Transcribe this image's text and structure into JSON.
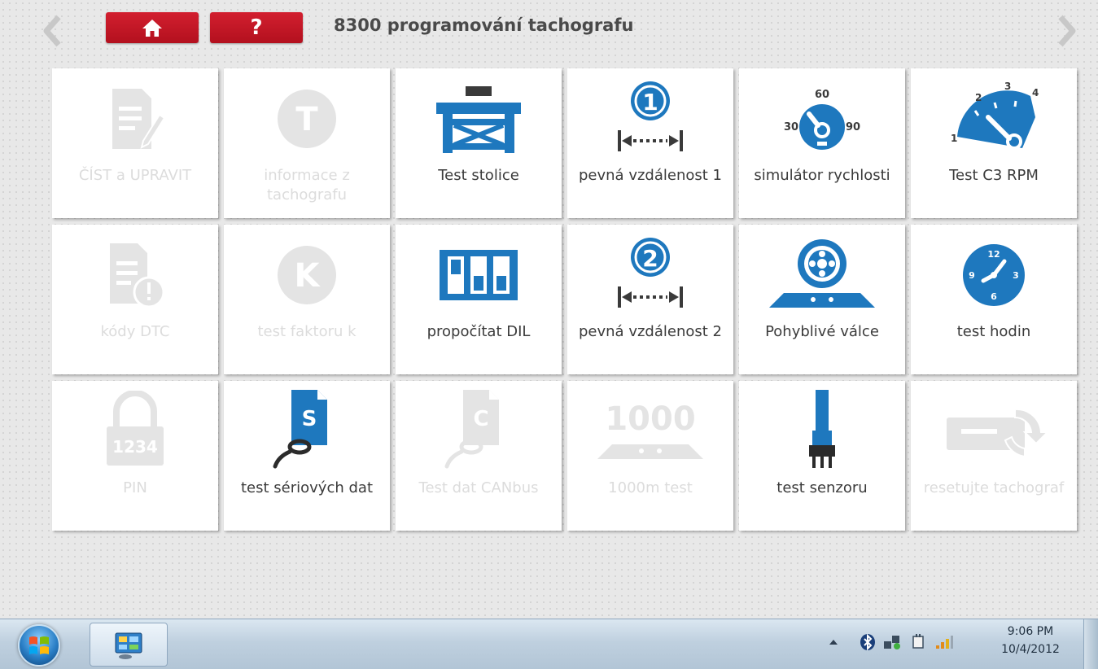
{
  "header": {
    "title": "8300 programování tachografu",
    "help_label": "?"
  },
  "tiles": [
    {
      "label": "ČÍST a UPRAVIT",
      "enabled": false,
      "icon": "edit-document-icon"
    },
    {
      "label": "informace z tachografu",
      "enabled": false,
      "icon": "t-circle-icon"
    },
    {
      "label": "Test stolice",
      "enabled": true,
      "icon": "test-bench-icon"
    },
    {
      "label": "pevná vzdálenost 1",
      "enabled": true,
      "icon": "fixed-distance-1-icon"
    },
    {
      "label": "simulátor rychlosti",
      "enabled": true,
      "icon": "speed-dial-icon"
    },
    {
      "label": "Test C3 RPM",
      "enabled": true,
      "icon": "rpm-gauge-icon"
    },
    {
      "label": "kódy DTC",
      "enabled": false,
      "icon": "dtc-document-icon"
    },
    {
      "label": "test faktoru k",
      "enabled": false,
      "icon": "k-circle-icon"
    },
    {
      "label": "propočítat DIL",
      "enabled": true,
      "icon": "dil-switch-icon"
    },
    {
      "label": "pevná vzdálenost 2",
      "enabled": true,
      "icon": "fixed-distance-2-icon"
    },
    {
      "label": "Pohyblivé válce",
      "enabled": true,
      "icon": "rolling-road-icon"
    },
    {
      "label": "test hodin",
      "enabled": true,
      "icon": "clock-icon"
    },
    {
      "label": "PIN",
      "enabled": false,
      "icon": "padlock-icon"
    },
    {
      "label": "test sériových dat",
      "enabled": true,
      "icon": "serial-data-icon"
    },
    {
      "label": "Test dat CANbus",
      "enabled": false,
      "icon": "canbus-data-icon"
    },
    {
      "label": "1000m test",
      "enabled": false,
      "icon": "1000m-icon"
    },
    {
      "label": "test senzoru",
      "enabled": true,
      "icon": "sensor-icon"
    },
    {
      "label": "resetujte tachograf",
      "enabled": false,
      "icon": "reset-tachograph-icon"
    }
  ],
  "icon_texts": {
    "pin_code": "1234",
    "serial_letter": "S",
    "canbus_letter": "C",
    "distance_1": "1",
    "distance_2": "2",
    "speed_30": "30",
    "speed_60": "60",
    "speed_90": "90",
    "rpm_1": "1",
    "rpm_2": "2",
    "rpm_3": "3",
    "rpm_4": "4",
    "clock_12": "12",
    "clock_3": "3",
    "clock_6": "6",
    "clock_9": "9",
    "thousand": "1000",
    "letter_t": "T",
    "letter_k": "K"
  },
  "taskbar": {
    "time": "9:06 PM",
    "date": "10/4/2012"
  },
  "colors": {
    "accent_red": "#c8141f",
    "icon_blue": "#1e78be",
    "disabled_gray": "#dcdcdc",
    "text_dark": "#3b3b3b"
  }
}
